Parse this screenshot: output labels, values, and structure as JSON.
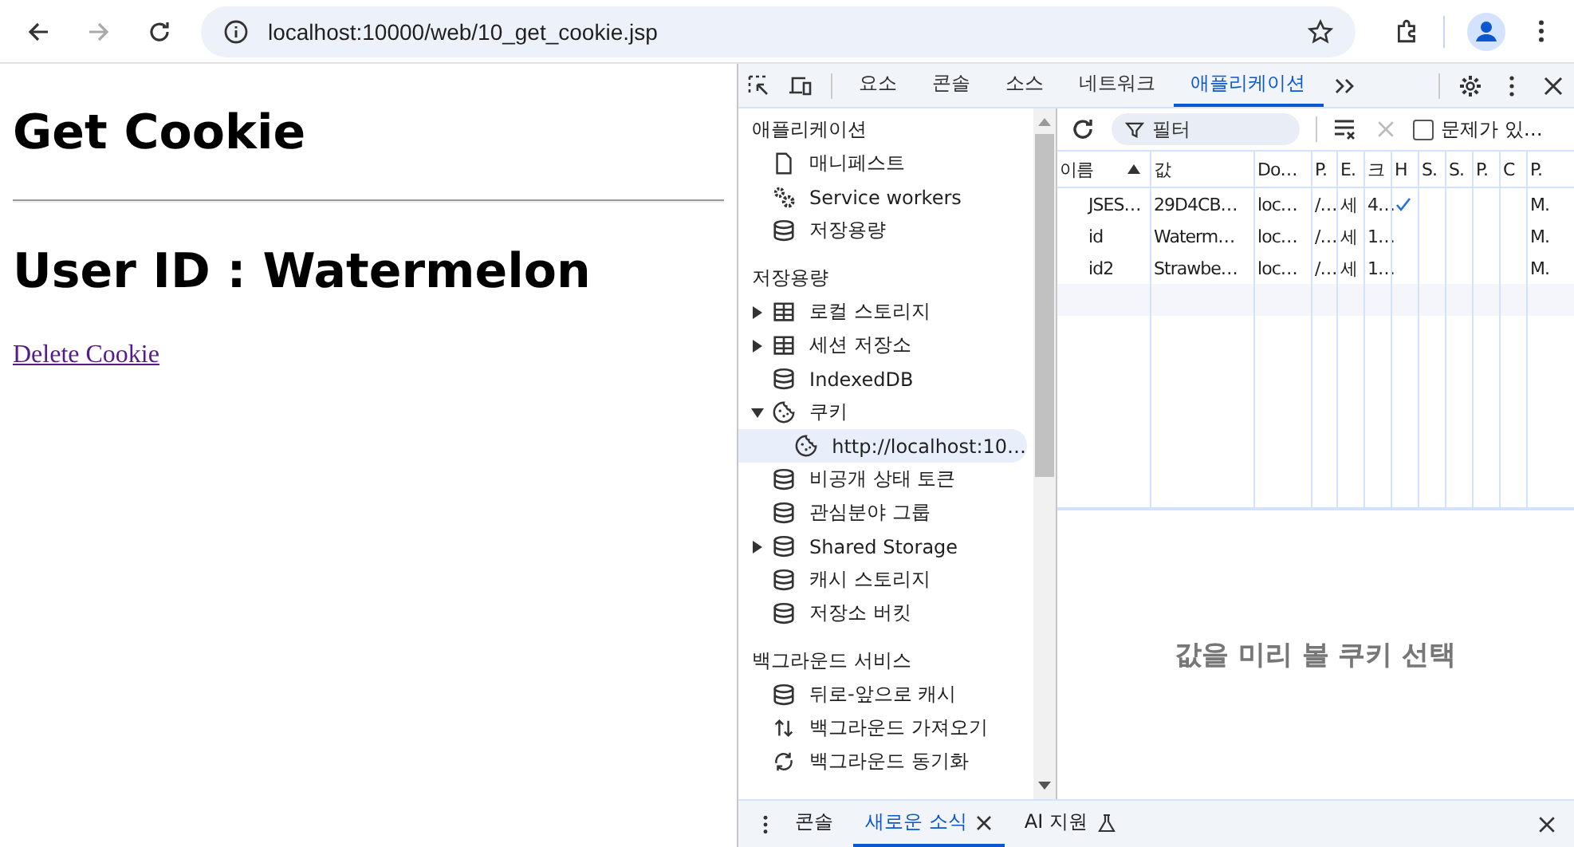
{
  "browser": {
    "url": "localhost:10000/web/10_get_cookie.jsp",
    "forward_disabled": true
  },
  "page": {
    "heading": "Get Cookie",
    "subheading": "User ID : Watermelon",
    "link": "Delete Cookie"
  },
  "devtools": {
    "tabs": [
      {
        "label": "요소",
        "selected": false
      },
      {
        "label": "콘솔",
        "selected": false
      },
      {
        "label": "소스",
        "selected": false
      },
      {
        "label": "네트워크",
        "selected": false
      },
      {
        "label": "애플리케이션",
        "selected": true
      }
    ],
    "sidebar": [
      {
        "title": "애플리케이션",
        "items": [
          {
            "label": "매니페스트",
            "kind": "file"
          },
          {
            "label": "Service workers",
            "kind": "gears"
          },
          {
            "label": "저장용량",
            "kind": "database"
          }
        ]
      },
      {
        "title": "저장용량",
        "items": [
          {
            "label": "로컬 스토리지",
            "kind": "table",
            "expanded": false
          },
          {
            "label": "세션 저장소",
            "kind": "table",
            "expanded": false
          },
          {
            "label": "IndexedDB",
            "kind": "database"
          },
          {
            "label": "쿠키",
            "kind": "cookie",
            "expanded": true,
            "children": [
              {
                "label": "http://localhost:10…",
                "kind": "cookie",
                "selected": true
              }
            ]
          },
          {
            "label": "비공개 상태 토큰",
            "kind": "database"
          },
          {
            "label": "관심분야 그룹",
            "kind": "database"
          },
          {
            "label": "Shared Storage",
            "kind": "database",
            "expanded": false
          },
          {
            "label": "캐시 스토리지",
            "kind": "database"
          },
          {
            "label": "저장소 버킷",
            "kind": "database"
          }
        ]
      },
      {
        "title": "백그라운드 서비스",
        "items": [
          {
            "label": "뒤로-앞으로 캐시",
            "kind": "database"
          },
          {
            "label": "백그라운드 가져오기",
            "kind": "arrows"
          },
          {
            "label": "백그라운드 동기화",
            "kind": "sync"
          }
        ]
      }
    ],
    "filter": {
      "placeholder": "필터"
    },
    "issues_checkbox": {
      "label": "문제가 있…",
      "checked": false
    },
    "columns": [
      {
        "label": "이름",
        "sorted": true
      },
      {
        "label": "값",
        "sorted": false
      },
      {
        "label": "Do…",
        "sorted": false
      },
      {
        "label": "P.",
        "sorted": false
      },
      {
        "label": "E.",
        "sorted": false
      },
      {
        "label": "크",
        "sorted": false
      },
      {
        "label": "H",
        "sorted": false
      },
      {
        "label": "S.",
        "sorted": false
      },
      {
        "label": "S.",
        "sorted": false
      },
      {
        "label": "P.",
        "sorted": false
      },
      {
        "label": "C",
        "sorted": false
      },
      {
        "label": "P.",
        "sorted": false
      }
    ],
    "rows": [
      {
        "name": "JSES…",
        "value": "29D4CB…",
        "domain": "loc…",
        "path": "/…",
        "expires": "세",
        "size": "4…",
        "http_only": true,
        "priority": "M."
      },
      {
        "name": "id",
        "value": "Waterm…",
        "domain": "loc…",
        "path": "/…",
        "expires": "세",
        "size": "1…",
        "http_only": false,
        "priority": "M."
      },
      {
        "name": "id2",
        "value": "Strawbe…",
        "domain": "loc…",
        "path": "/…",
        "expires": "세",
        "size": "1…",
        "http_only": false,
        "priority": "M."
      }
    ],
    "preview_hint": "값을 미리 볼 쿠키 선택",
    "drawer_tabs": [
      {
        "label": "콘솔",
        "selected": false,
        "kind": "plain"
      },
      {
        "label": "새로운 소식",
        "selected": true,
        "kind": "closable"
      },
      {
        "label": "AI 지원",
        "selected": false,
        "kind": "experiment"
      }
    ]
  }
}
